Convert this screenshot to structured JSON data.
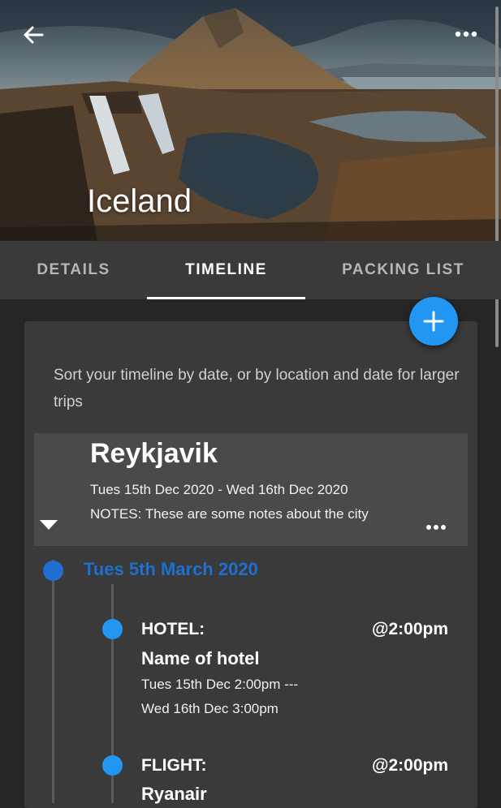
{
  "hero": {
    "title": "Iceland"
  },
  "tabs": [
    {
      "label": "DETAILS"
    },
    {
      "label": "TIMELINE",
      "active": true
    },
    {
      "label": "PACKING LIST"
    }
  ],
  "fab": {
    "label": "+"
  },
  "hint": "Sort your timeline by date, or by location and date for larger trips",
  "city": {
    "name": "Reykjavik",
    "dates": "Tues 15th Dec 2020 - Wed 16th Dec 2020",
    "notes": "NOTES: These are some notes about the city"
  },
  "day": {
    "label": "Tues 5th March 2020"
  },
  "events": [
    {
      "type": "HOTEL:",
      "time": "@2:00pm",
      "name": "Name of hotel",
      "line1": "Tues 15th Dec 2:00pm ---",
      "line2": "Wed 16th Dec 3:00pm"
    },
    {
      "type": "FLIGHT:",
      "time": "@2:00pm",
      "name": "Ryanair"
    }
  ],
  "colors": {
    "accent": "#2196f3",
    "day": "#1e6fd0",
    "tabs_bg": "#3a3a3a",
    "card_bg": "#3a3a3a"
  },
  "icons": {
    "back": "arrow-left-icon",
    "more": "more-horiz-icon",
    "expand": "triangle-down-icon",
    "add": "plus-icon"
  }
}
